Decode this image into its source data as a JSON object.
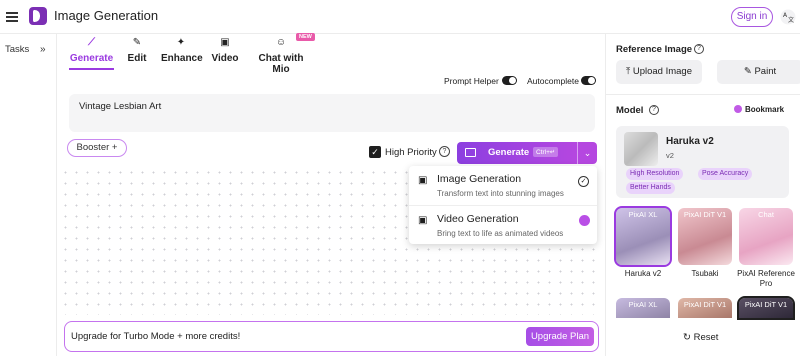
{
  "header": {
    "app_title": "Image Generation",
    "signin_label": "Sign in"
  },
  "sidebar": {
    "tasks_label": "Tasks",
    "expand_icon": "»"
  },
  "tabs": [
    {
      "label": "Generate",
      "icon": "wand-icon",
      "glyph": "⟋",
      "active": true
    },
    {
      "label": "Edit",
      "icon": "brush-icon",
      "glyph": "✎",
      "active": false
    },
    {
      "label": "Enhance",
      "icon": "sparkle-icon",
      "glyph": "✦",
      "active": false
    },
    {
      "label": "Video",
      "icon": "video-icon",
      "glyph": "▣",
      "active": false
    },
    {
      "label": "Chat with Mio",
      "icon": "mio-icon",
      "glyph": "☺",
      "active": false
    }
  ],
  "new_badge": "NEW",
  "toggles": {
    "prompt_helper": "Prompt Helper",
    "autocomplete": "Autocomplete"
  },
  "prompt": {
    "value": "Vintage Lesbian Art"
  },
  "booster_label": "Booster +",
  "high_priority": {
    "label": "High Priority",
    "checked": true
  },
  "generate": {
    "label": "Generate",
    "shortcut": "Ctrl+↵"
  },
  "menu": {
    "items": [
      {
        "title": "Image Generation",
        "subtitle": "Transform text into stunning images",
        "status": "selected"
      },
      {
        "title": "Video Generation",
        "subtitle": "Bring text to life as animated videos",
        "status": "premium"
      }
    ]
  },
  "upgrade": {
    "text": "Upgrade for Turbo Mode + more credits!",
    "button": "Upgrade Plan"
  },
  "right_panel": {
    "reference_title": "Reference Image",
    "upload_label": "Upload Image",
    "paint_label": "Paint",
    "model_title": "Model",
    "bookmark_label": "Bookmark",
    "selected_model": {
      "name": "Haruka v2",
      "version": "v2",
      "tags": [
        "High Resolution",
        "Pose Accuracy",
        "Better Hands"
      ]
    },
    "thumbnails": [
      {
        "badge": "PixAI XL",
        "caption": "Haruka v2"
      },
      {
        "badge": "PixAI DiT V1",
        "caption": "Tsubaki"
      },
      {
        "badge": "Chat",
        "caption": "PixAI Reference Pro"
      }
    ],
    "thumbnails_row2": [
      "PixAI XL",
      "PixAI DiT V1",
      "PixAI DiT V1"
    ],
    "reset_label": "Reset"
  },
  "colors": {
    "accent": "#9a3ae0",
    "brand": "#7b2fb4"
  }
}
